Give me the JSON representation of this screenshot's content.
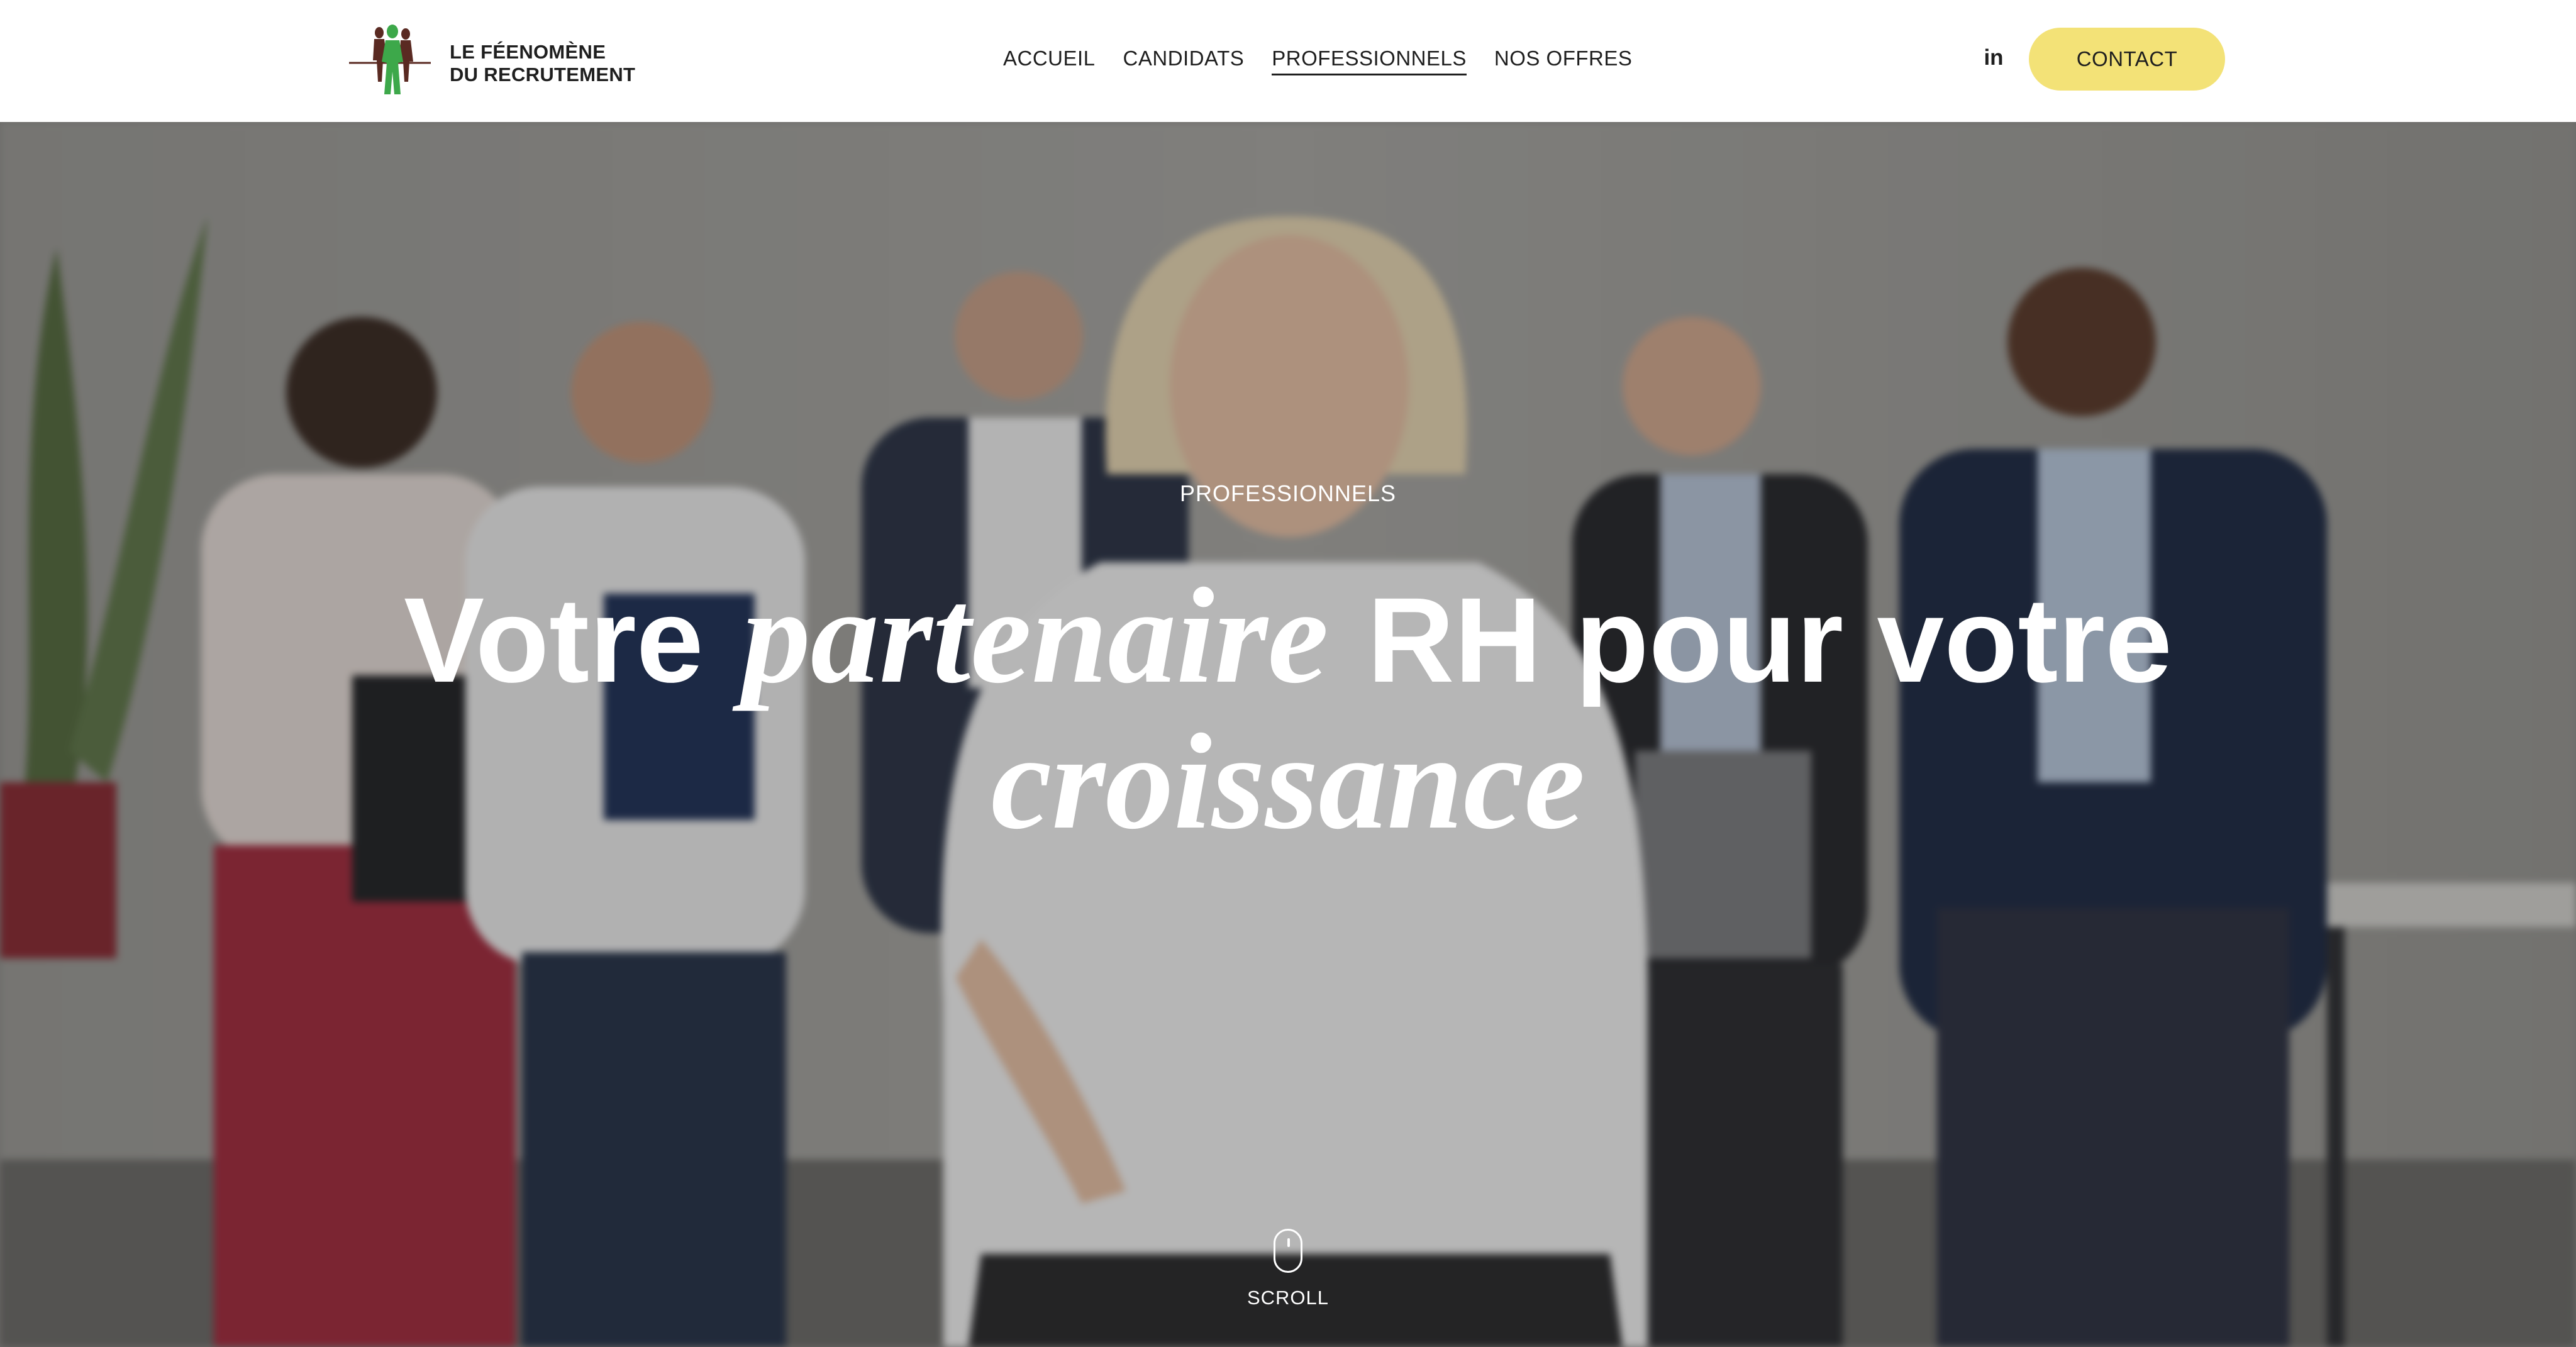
{
  "header": {
    "logo_line1": "LE FÉENOMÈNE",
    "logo_line2": "DU RECRUTEMENT",
    "nav": [
      {
        "label": "ACCUEIL",
        "active": false
      },
      {
        "label": "CANDIDATS",
        "active": false
      },
      {
        "label": "PROFESSIONNELS",
        "active": true
      },
      {
        "label": "NOS OFFRES",
        "active": false
      }
    ],
    "linkedin_label": "in",
    "contact_label": "CONTACT"
  },
  "hero": {
    "eyebrow": "PROFESSIONNELS",
    "title_part1": "Votre",
    "title_highlight1": "partenaire",
    "title_part2": "RH pour votre",
    "title_highlight2": "croissance",
    "scroll_label": "SCROLL"
  },
  "colors": {
    "accent_yellow": "#f3e277",
    "highlight_green": "#1c6a4c",
    "logo_green": "#3da84a",
    "text_dark": "#1f1f1f"
  },
  "icons": [
    "linkedin-icon",
    "mouse-scroll-icon"
  ]
}
